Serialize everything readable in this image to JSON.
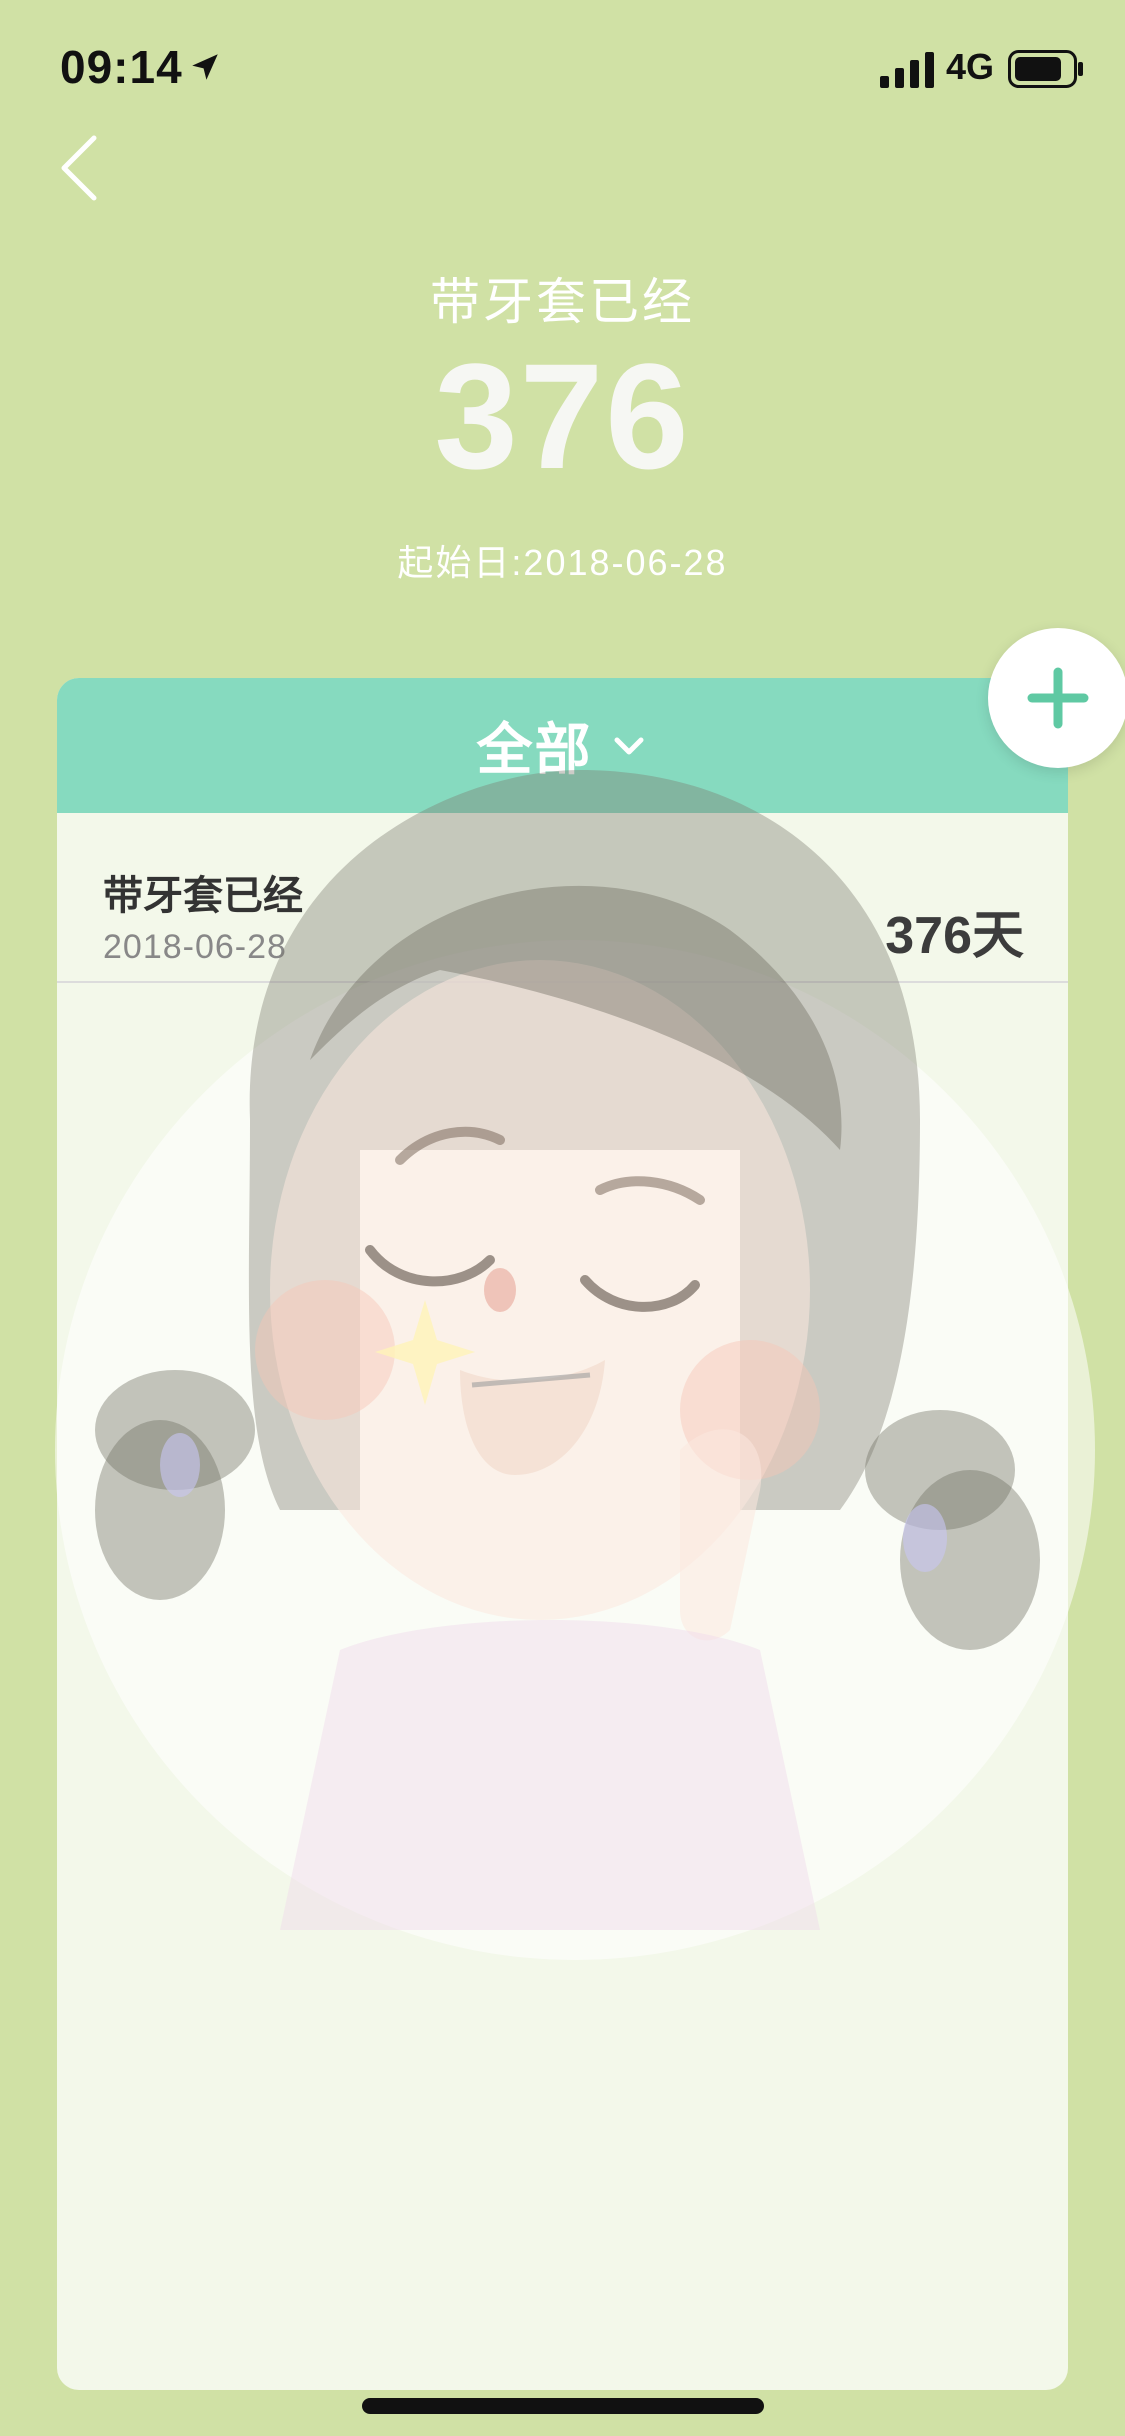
{
  "status_bar": {
    "time": "09:14",
    "network": "4G",
    "icons": [
      "location-arrow-icon",
      "signal-icon",
      "battery-icon"
    ]
  },
  "nav": {
    "back_icon": "chevron-left-icon"
  },
  "counter": {
    "title": "带牙套已经",
    "value": "376",
    "start_date": "起始日:2018-06-28"
  },
  "card": {
    "filter_label": "全部",
    "filter_icon": "chevron-down-icon",
    "items": [
      {
        "title": "带牙套已经",
        "date": "2018-06-28",
        "days": "376天"
      }
    ]
  },
  "add_button": {
    "icon": "plus-icon"
  },
  "colors": {
    "background": "#d0e1a5",
    "card_header": "#86dabf",
    "card_body": "#f3f8ea",
    "accent": "#5fc9a3"
  }
}
